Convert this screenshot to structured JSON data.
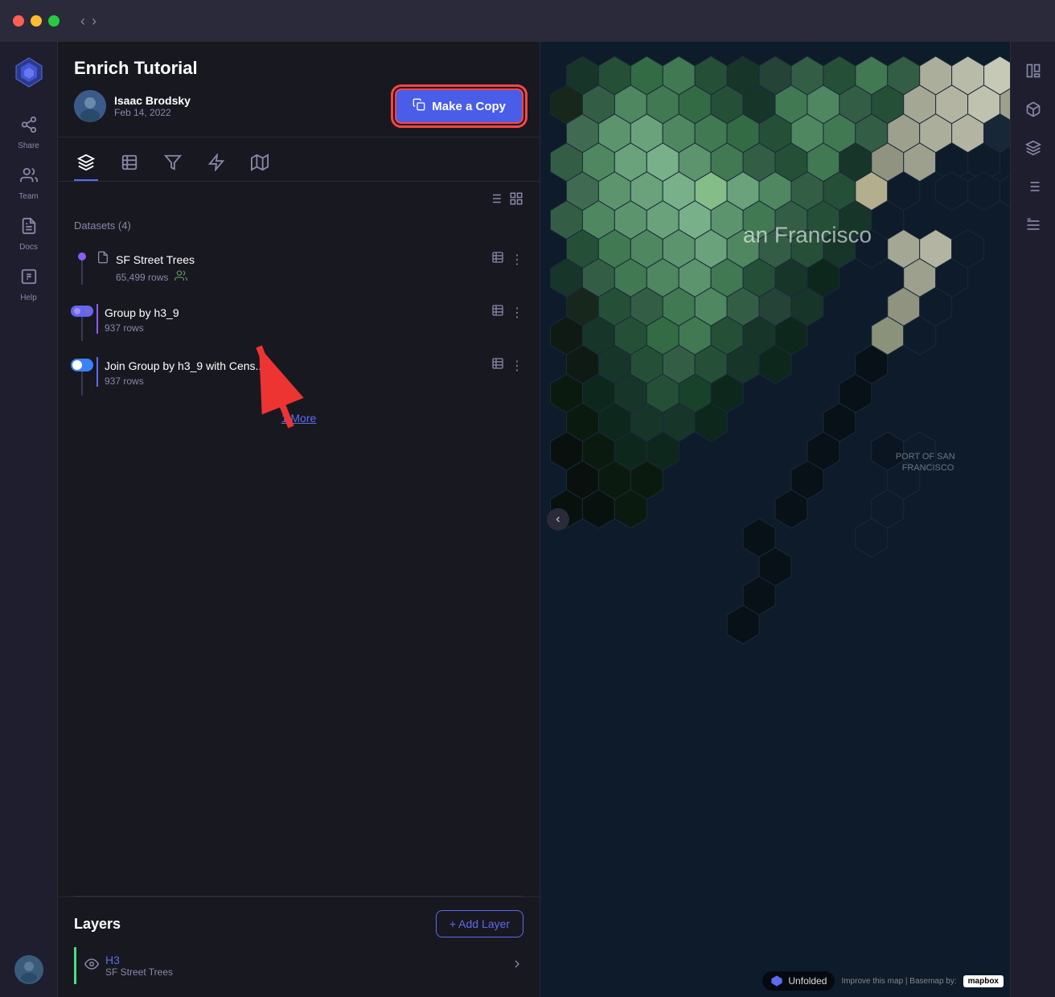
{
  "titlebar": {
    "nav_back": "‹",
    "nav_forward": "›"
  },
  "sidebar": {
    "share_label": "Share",
    "team_label": "Team",
    "docs_label": "Docs",
    "help_label": "Help"
  },
  "panel": {
    "title": "Enrich Tutorial",
    "user_name": "Isaac Brodsky",
    "user_date": "Feb 14, 2022",
    "make_copy_label": "Make a Copy",
    "tabs": [
      "layers",
      "table",
      "filter",
      "map"
    ],
    "datasets_header": "Datasets (4)",
    "datasets": [
      {
        "name": "SF Street Trees",
        "rows": "65,499 rows",
        "has_team": true
      },
      {
        "name": "Group by h3_9",
        "rows": "937 rows",
        "has_team": false,
        "type": "group"
      },
      {
        "name": "Join Group by h3_9 with Cens...",
        "rows": "937 rows",
        "has_team": false,
        "type": "join"
      }
    ],
    "more_link": "1 More",
    "layers_title": "Layers",
    "add_layer_label": "+ Add Layer",
    "layer": {
      "name": "H3",
      "sub": "SF Street Trees"
    }
  },
  "map": {
    "city_label": "an Francisco",
    "port_label": "PORT OF SAN FRANCISCO",
    "unfolded_label": "Unfolded",
    "mapbox_label": "Improve this map | Basemap by:",
    "mapbox_brand": "mapbox"
  },
  "right_tools": [
    "panels",
    "cube",
    "magic",
    "list",
    "list-alt"
  ]
}
